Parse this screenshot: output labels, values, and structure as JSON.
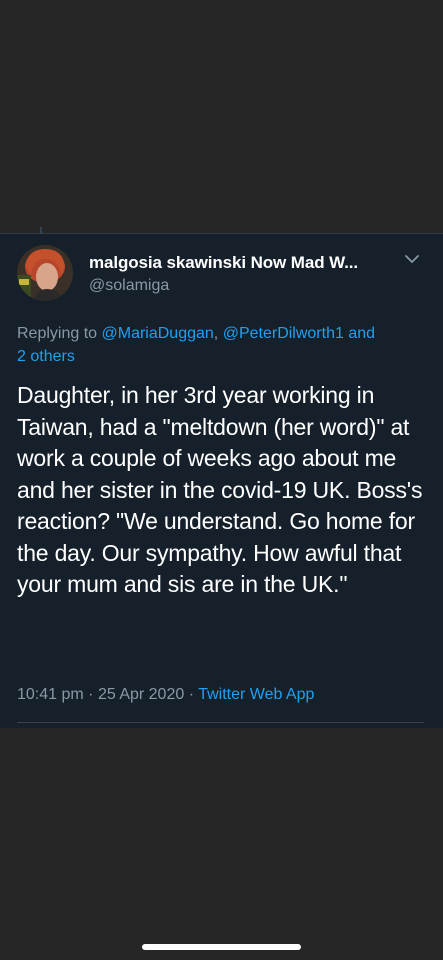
{
  "tweet": {
    "author_name": "malgosia skawinski Now Mad W...",
    "author_handle": "@solamiga",
    "replying_prefix": "Replying to",
    "replying_user1": "@MariaDuggan",
    "replying_sep": ",",
    "replying_user2": "@PeterDilworth1 and",
    "replying_others": "2 others",
    "text": "Daughter, in her 3rd year working in Taiwan, had a \"meltdown (her word)\" at work a couple of weeks ago about me and her sister in the covid-19 UK. Boss's reaction? \"We understand. Go home for the day. Our sympathy. How awful that your mum and sis are in the UK.\"",
    "time": "10:41 pm",
    "date": "25 Apr 2020",
    "dot": "·",
    "source": "Twitter Web App"
  },
  "icons": {
    "avatar": "avatar",
    "menu": "chevron-down-icon"
  },
  "colors": {
    "background": "#262626",
    "card": "#15202b",
    "secondary_text": "#8899a6",
    "link": "#1da1f2",
    "divider": "#38444d"
  }
}
